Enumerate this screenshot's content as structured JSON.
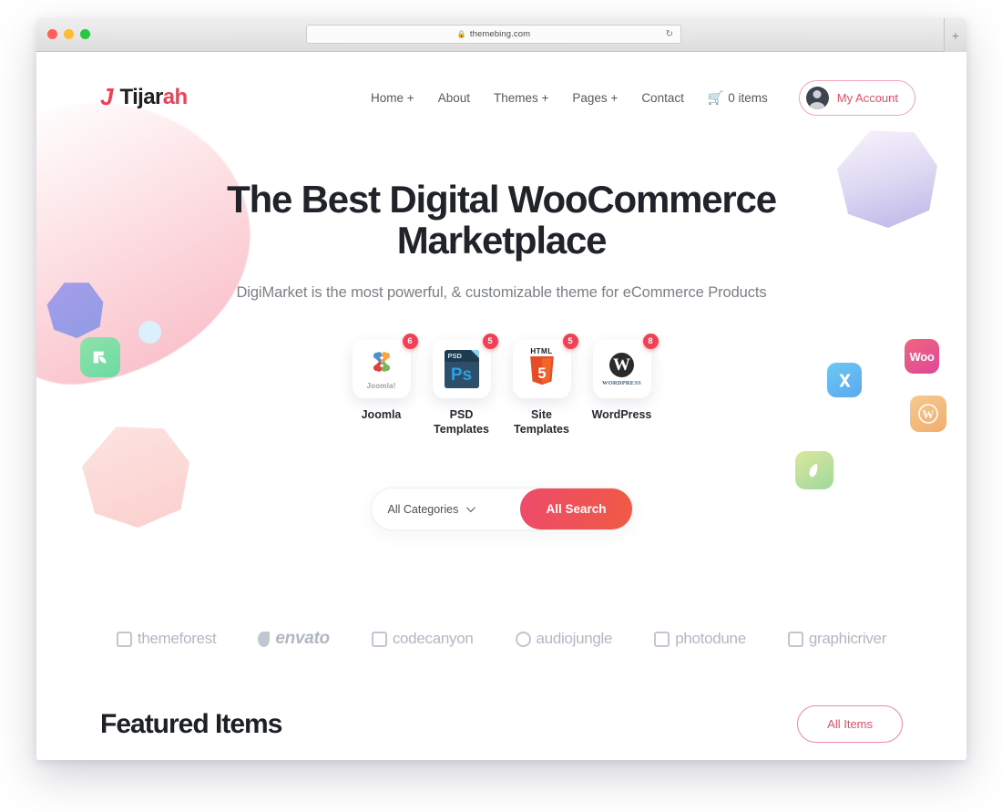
{
  "browser": {
    "url": "themebing.com",
    "lock_icon": "lock-icon",
    "reload_icon": "reload-icon",
    "newtab_label": "+"
  },
  "header": {
    "logo_mark": "J",
    "logo_text_main": "Tijar",
    "logo_text_accent": "ah",
    "nav": [
      {
        "label": "Home +"
      },
      {
        "label": "About"
      },
      {
        "label": "Themes +"
      },
      {
        "label": "Pages +"
      },
      {
        "label": "Contact"
      }
    ],
    "cart_label": "0 items",
    "cart_icon": "shopping-cart-icon",
    "account_label": "My Account",
    "account_icon": "avatar-icon"
  },
  "hero": {
    "title": "The Best Digital WooCommerce Marketplace",
    "subtitle": "DigiMarket is the most powerful, & customizable theme for eCommerce Products"
  },
  "categories": [
    {
      "label": "Joomla",
      "badge": "6",
      "icon": "joomla-icon",
      "word": "Joomla!"
    },
    {
      "label": "PSD Templates",
      "badge": "5",
      "icon": "photoshop-psd-icon",
      "word": "PSD",
      "sub": "Ps"
    },
    {
      "label": "Site Templates",
      "badge": "5",
      "icon": "html5-icon",
      "word": "HTML",
      "sub": "5"
    },
    {
      "label": "WordPress",
      "badge": "8",
      "icon": "wordpress-icon",
      "word": "W",
      "sub": "WORDPRESS"
    }
  ],
  "search": {
    "category_value": "All Categories",
    "dropdown_icon": "chevron-down-icon",
    "button_label": "All Search"
  },
  "brands": [
    {
      "label": "themeforest",
      "icon": "themeforest-icon"
    },
    {
      "label": "envato",
      "icon": "envato-icon"
    },
    {
      "label": "codecanyon",
      "icon": "codecanyon-icon"
    },
    {
      "label": "audiojungle",
      "icon": "audiojungle-icon"
    },
    {
      "label": "photodune",
      "icon": "photodune-icon"
    },
    {
      "label": "graphicriver",
      "icon": "graphicriver-icon"
    }
  ],
  "featured": {
    "title": "Featured Items",
    "all_items_label": "All Items"
  },
  "decorations": {
    "woo_label": "Woo",
    "wp_label": "W",
    "x_label": "X"
  },
  "colors": {
    "accent": "#ef4056",
    "accent_soft": "#ef4a68",
    "heading": "#20232a",
    "muted": "#7b8086"
  }
}
